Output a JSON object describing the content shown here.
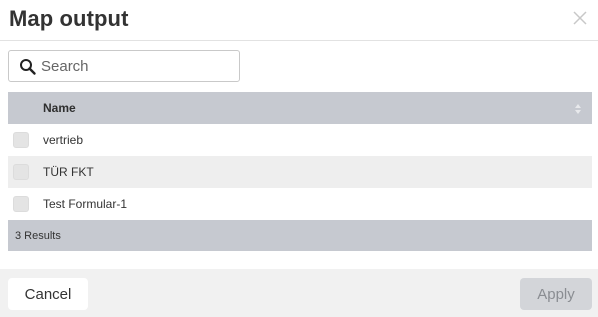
{
  "dialog": {
    "title": "Map output",
    "close_icon": "close-icon"
  },
  "search": {
    "placeholder": "Search",
    "value": "",
    "icon": "search-icon"
  },
  "table": {
    "header": {
      "name": "Name",
      "sort_icon": "sort-icon"
    },
    "rows": [
      {
        "label": "vertrieb",
        "checked": false
      },
      {
        "label": "TÜR FKT",
        "checked": false
      },
      {
        "label": "Test Formular-1",
        "checked": false
      }
    ],
    "footer": "3 Results"
  },
  "buttons": {
    "cancel": "Cancel",
    "apply": "Apply",
    "apply_disabled": true
  }
}
